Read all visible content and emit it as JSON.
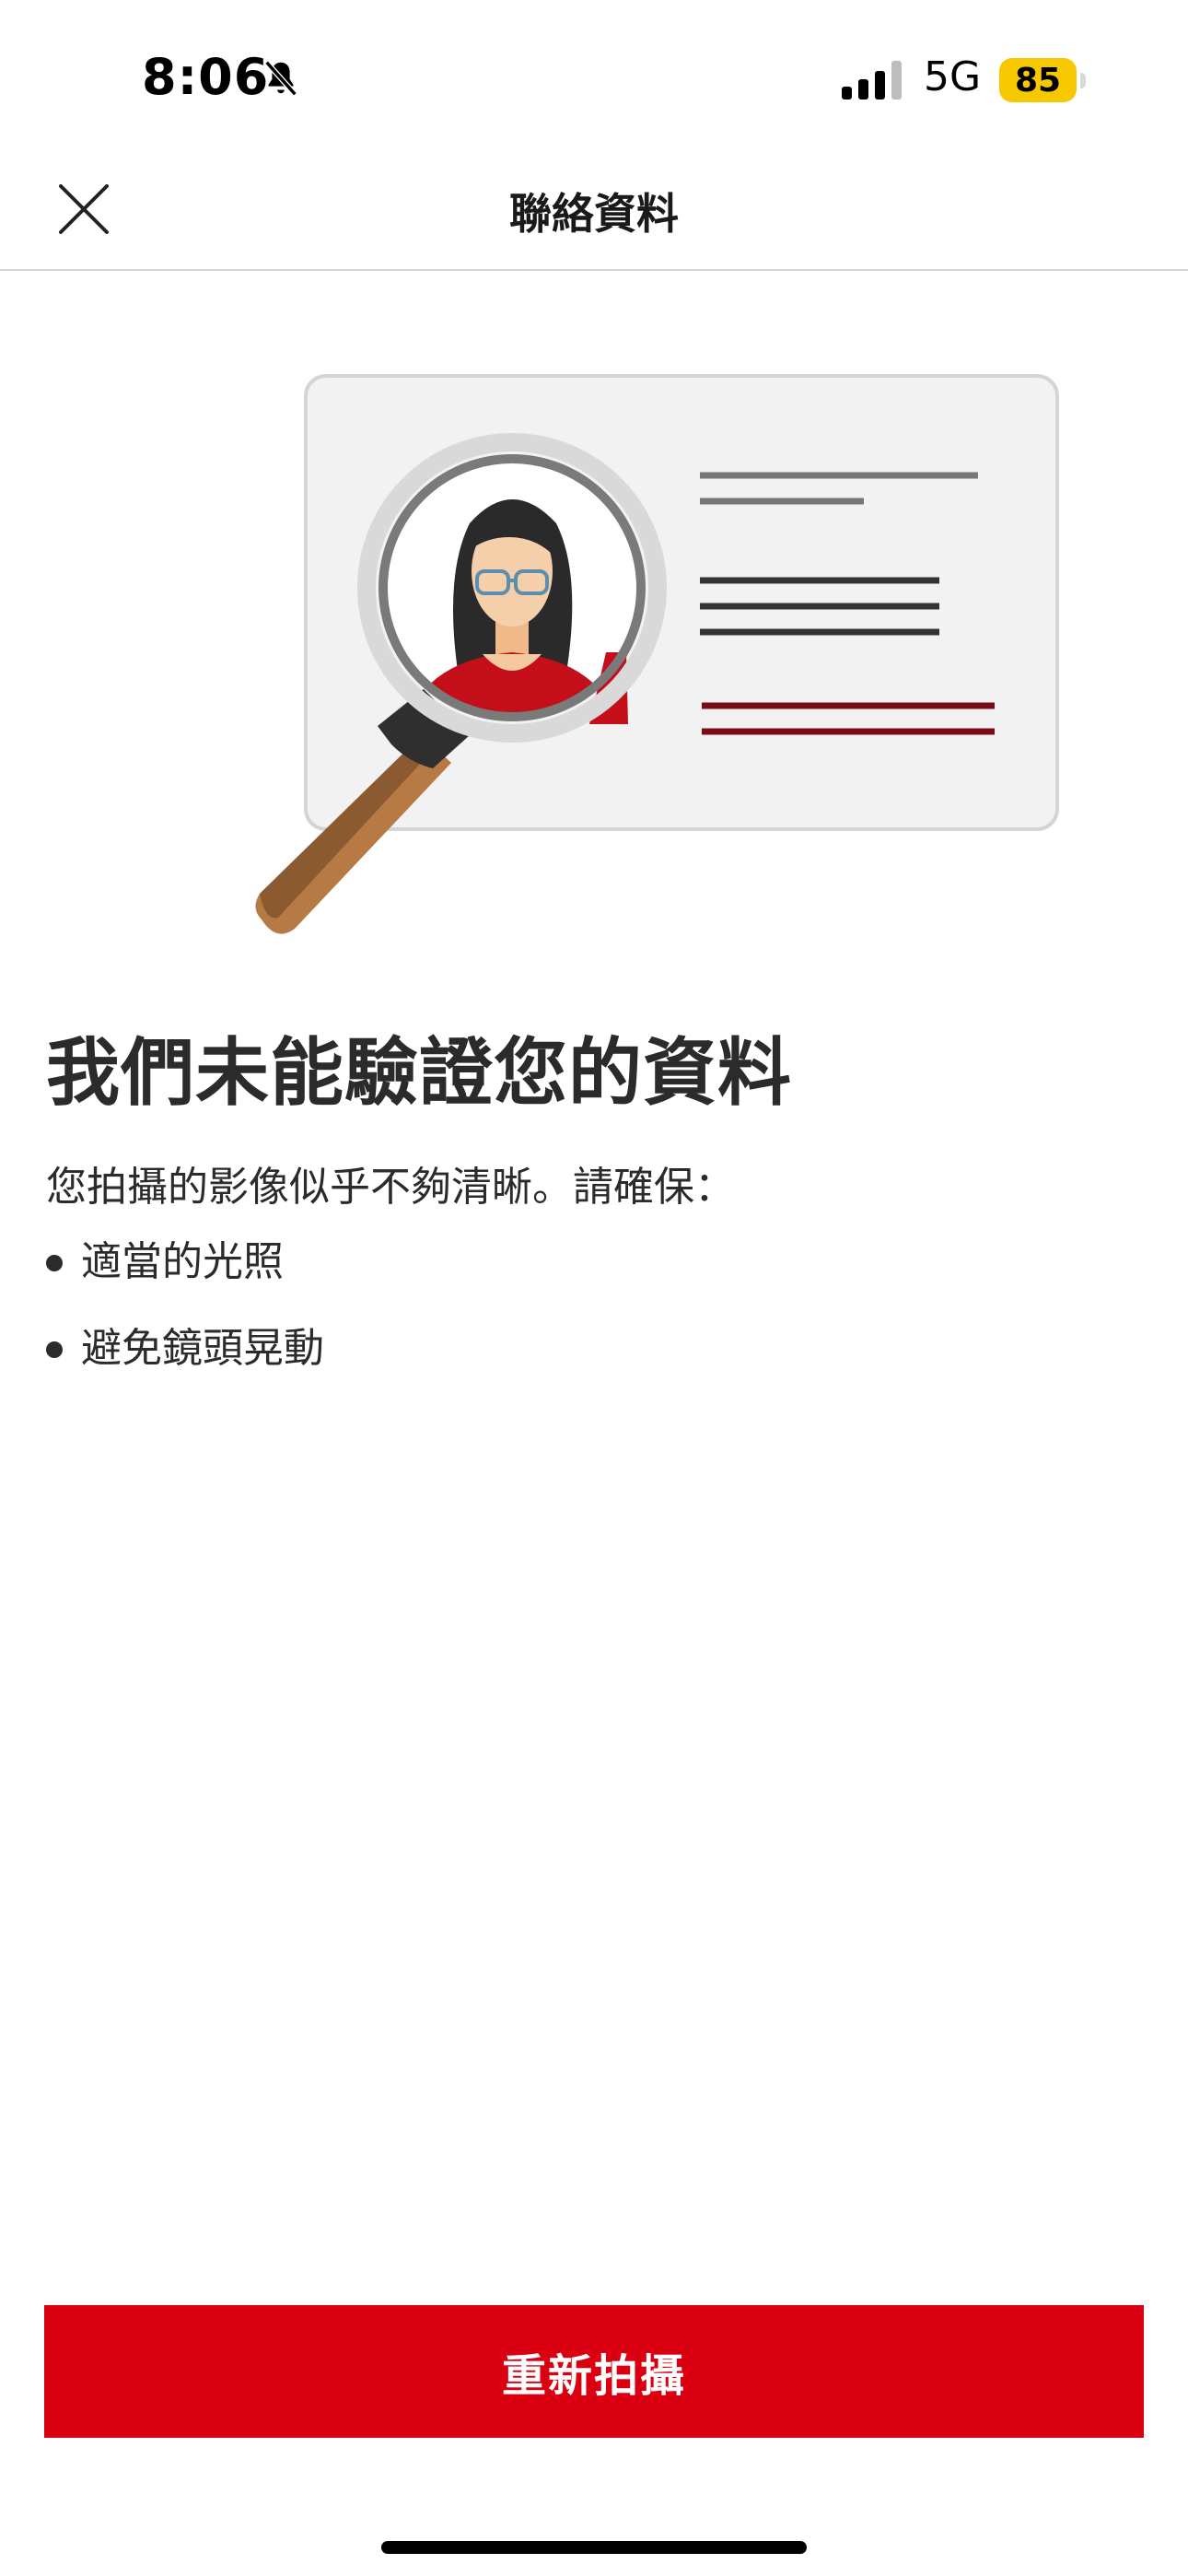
{
  "status_bar": {
    "time": "8:06",
    "network": "5G",
    "battery": "85",
    "battery_color": "#f6c800"
  },
  "nav": {
    "title": "聯絡資料",
    "close_icon": "close-icon"
  },
  "content": {
    "headline": "我們未能驗證您的資料",
    "description": "您拍攝的影像似乎不夠清晰。請確保：",
    "tips": [
      "適當的光照",
      "避免鏡頭晃動"
    ]
  },
  "actions": {
    "retake_label": "重新拍攝",
    "accent_color": "#db0011"
  }
}
